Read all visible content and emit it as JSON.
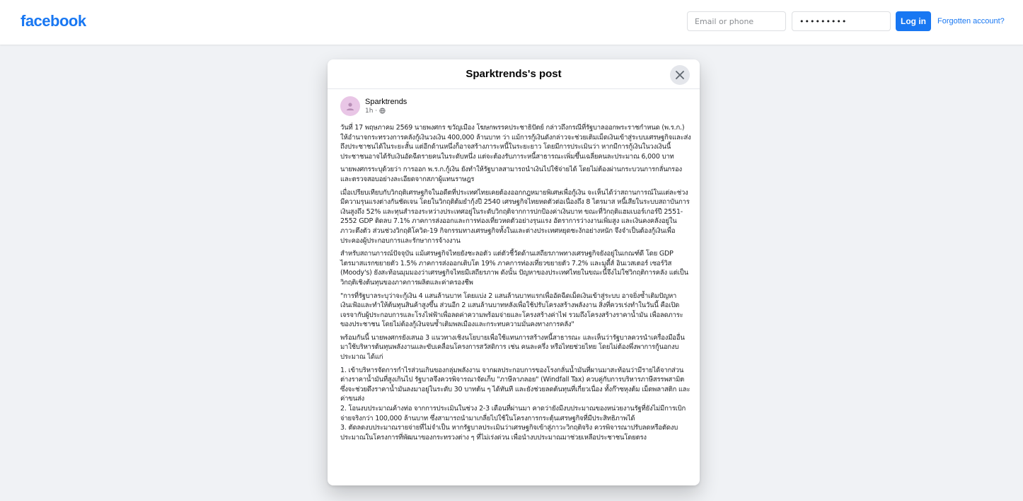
{
  "header": {
    "logo_text": "facebook",
    "email_placeholder": "Email or phone",
    "password_mask": "•••••••••",
    "login_label": "Log in",
    "forgot_label": "Forgotten account?"
  },
  "modal": {
    "title": "Sparktrends's post"
  },
  "post": {
    "author": "Sparktrends",
    "time": "1h ·",
    "paragraphs": [
      "วันที่ 17 พฤษภาคม 2569 นายพงศกร ขวัญเมือง โฆษกพรรคประชาธิปัตย์ กล่าวถึงกรณีที่รัฐบาลออกพระราชกำหนด (พ.ร.ก.) ให้อำนาจกระทรวงการคลังกู้เงินวงเงิน 400,000 ล้านบาท ว่า แม้การกู้เงินดังกล่าวจะช่วยเติมเม็ดเงินเข้าสู่ระบบเศรษฐกิจและส่งถึงประชาชนได้ในระยะสั้น แต่อีกด้านหนึ่งก็อาจสร้างภาระหนี้ในระยะยาว โดยมีการประเมินว่า หากมีการกู้เงินในวงเงินนี้ ประชาชนอาจได้รับเงินอัดฉีดรายคนในระดับหนึ่ง แต่จะต้องรับภาระหนี้สาธารณะเพิ่มขึ้นเฉลี่ยคนละประมาณ 6,000 บาท",
      "นายพงศกรระบุด้วยว่า การออก พ.ร.ก.กู้เงิน ยังทำให้รัฐบาลสามารถนำเงินไปใช้จ่ายได้ โดยไม่ต้องผ่านกระบวนการกลั่นกรองและตรวจสอบอย่างละเอียดจากสภาผู้แทนราษฎร",
      "เมื่อเปรียบเทียบกับวิกฤติเศรษฐกิจในอดีตที่ประเทศไทยเคยต้องออกกฎหมายพิเศษเพื่อกู้เงิน จะเห็นได้ว่าสถานการณ์ในแต่ละช่วงมีความรุนแรงต่างกันชัดเจน โดยในวิกฤติต้มยำกุ้งปี 2540 เศรษฐกิจไทยหดตัวต่อเนื่องถึง 8 ไตรมาส หนี้เสียในระบบสถาบันการเงินสูงถึง 52% และทุนสำรองระหว่างประเทศอยู่ในระดับวิกฤติจากการปกป้องค่าเงินบาท ขณะที่วิกฤติแฮมเบอร์เกอร์ปี 2551-2552 GDP ติดลบ 7.1% ภาคการส่งออกและการท่องเที่ยวหดตัวอย่างรุนแรง อัตราการว่างงานเพิ่มสูง และเงินคงคลังอยู่ในภาวะตึงตัว ส่วนช่วงวิกฤติโควิด-19 กิจกรรมทางเศรษฐกิจทั้งในและต่างประเทศหยุดชะงักอย่างหนัก จึงจำเป็นต้องกู้เงินเพื่อประคองผู้ประกอบการและรักษาการจ้างงาน",
      "สำหรับสถานการณ์ปัจจุบัน แม้เศรษฐกิจไทยยังชะลอตัว แต่ตัวชี้วัดด้านเสถียรภาพทางเศรษฐกิจยังอยู่ในเกณฑ์ดี โดย GDP ไตรมาสแรกขยายตัว 1.5% ภาคการส่งออกเติบโต 19% ภาคการท่องเที่ยวขยายตัว 7.2% และมูดี้ส์ อินเวสเตอร์ เซอร์วิส (Moody's) ยังสะท้อนมุมมองว่าเศรษฐกิจไทยมีเสถียรภาพ ดังนั้น ปัญหาของประเทศไทยในขณะนี้จึงไม่ใช่วิกฤติการคลัง แต่เป็นวิกฤติเชิงต้นทุนของภาคการผลิตและค่าครองชีพ",
      "\"การที่รัฐบาลระบุว่าจะกู้เงิน 4 แสนล้านบาท โดยแบ่ง 2 แสนล้านบาทแรกเพื่ออัดฉีดเม็ดเงินเข้าสู่ระบบ อาจยิ่งซ้ำเติมปัญหาเงินเฟ้อและทำให้ต้นทุนสินค้าสูงขึ้น ส่วนอีก 2 แสนล้านบาทหลังเพื่อใช้ปรับโครงสร้างพลังงาน สิ่งที่ควรเร่งทำในวันนี้ คือเปิดเจรจากับผู้ประกอบการและโรงไฟฟ้าเพื่อลดค่าความพร้อมจ่ายและโครงสร้างค่าไฟ รวมถึงโครงสร้างราคาน้ำมัน เพื่อลดภาระของประชาชน โดยไม่ต้องกู้เงินจนซ้ำเติมพลเมืองและกระทบความมั่นคงทางการคลัง\"",
      "พร้อมกันนี้ นายพงศกรยังเสนอ 3 แนวทางเชิงนโยบายเพื่อใช้แทนการสร้างหนี้สาธารณะ และเห็นว่ารัฐบาลควรนำเครื่องมืออื่นมาใช้บริหารต้นทุนพลังงานและขับเคลื่อนโครงการสวัสดิการ เช่น คนละครึ่ง หรือไทยช่วยไทย โดยไม่ต้องพึ่งพาการกู้นอกงบประมาณ ได้แก่",
      "1. เข้าบริหารจัดการกำไรส่วนเกินของกลุ่มพลังงาน จากผลประกอบการของโรงกลั่นน้ำมันที่ผานมาสะท้อนว่ามีรายได้จากส่วนต่างราคาน้ำมันที่สูงเกินไป รัฐบาลจึงควรพิจารณาจัดเก็บ \"ภาษีลาภลอย\" (Windfall Tax) ควบคู่กับการบริหารภาษีสรรพสามิต ซึ่งจะช่วยดึงราคาน้ำมันลงมาอยู่ในระดับ 30 บาทต้น ๆ ได้ทันที และยังช่วยลดต้นทุนที่เกี่ยวเนื่อง ทั้งก๊าซหุงต้ม เม็ดพลาสติก และค่าขนส่ง\n2. โอนงบประมาณค้างท่อ จากการประเมินในช่วง 2-3 เดือนที่ผ่านมา คาดว่ายังมีงบประมาณของหน่วยงานรัฐที่ยังไม่มีการเบิกจ่ายจริงกว่า 100,000 ล้านบาท ซึ่งสามารถนำมาเกลี่ยไปใช้ในโครงการกระตุ้นเศรษฐกิจที่มีประสิทธิภาพได้\n3. ตัดลดงบประมาณรายจ่ายที่ไม่จำเป็น หากรัฐบาลประเมินว่าเศรษฐกิจเข้าสู่ภาวะวิกฤติจริง ควรพิจารณาปรับลดหรือตัดงบประมาณในโครงการที่พัฒนาของกระทรวงต่าง ๆ ที่ไม่เร่งด่วน เพื่อนำงบประมาณมาช่วยเหลือประชาชนโดยตรง"
    ]
  },
  "colors": {
    "brand": "#1877f2",
    "page_background": "#f0f2f5",
    "avatar_background": "#e9c6e6"
  },
  "icons": {
    "close": "close-icon",
    "globe": "globe-icon",
    "avatar": "person-icon"
  }
}
